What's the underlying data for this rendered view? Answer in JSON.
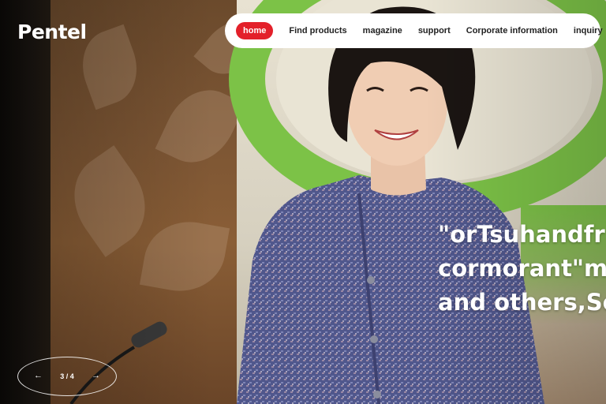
{
  "brand": {
    "logo_text": "Pentel"
  },
  "nav": {
    "items": [
      {
        "label": "home",
        "active": true
      },
      {
        "label": "Find products"
      },
      {
        "label": "magazine"
      },
      {
        "label": "support"
      },
      {
        "label": "Corporate information"
      },
      {
        "label": "inquiry"
      }
    ]
  },
  "hero": {
    "headline_lines": [
      "\"orTsuhandfr",
      "cormorant\"m",
      "and others,Se"
    ]
  },
  "slider": {
    "counter": "3 / 4",
    "prev_icon": "arrow-left-icon",
    "next_icon": "arrow-right-icon",
    "prev_glyph": "←",
    "next_glyph": "→"
  },
  "colors": {
    "accent": "#e3202a",
    "green": "#7cc247",
    "jacket": "#5b5f8f"
  }
}
